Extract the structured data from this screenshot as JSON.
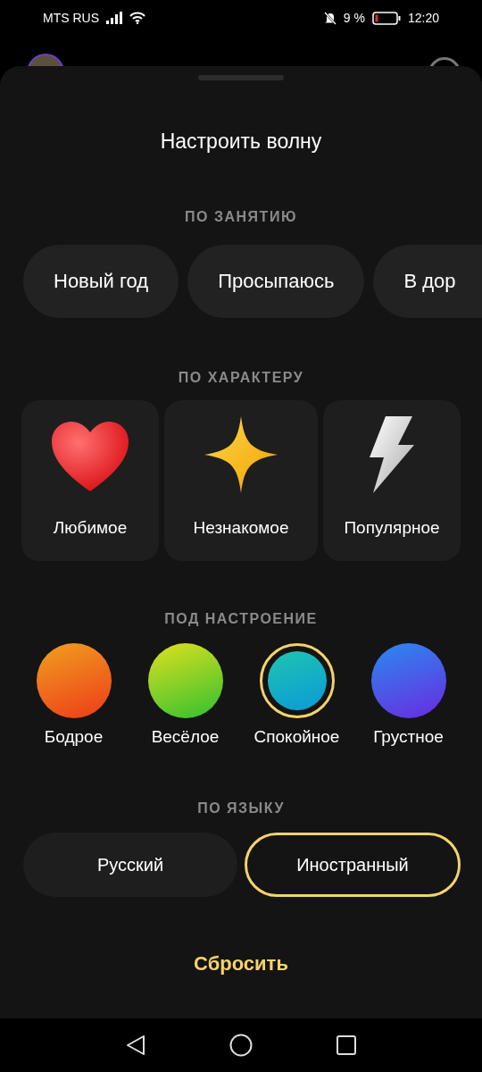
{
  "status_bar": {
    "carrier": "MTS RUS",
    "battery_percent": "9 %",
    "time": "12:20"
  },
  "sheet": {
    "title": "Настроить волну",
    "activity": {
      "heading": "ПО ЗАНЯТИЮ",
      "chips": [
        {
          "label": "Новый год"
        },
        {
          "label": "Просыпаюсь"
        },
        {
          "label": "В дор"
        }
      ]
    },
    "character": {
      "heading": "ПО ХАРАКТЕРУ",
      "cards": [
        {
          "label": "Любимое",
          "kind": "heart"
        },
        {
          "label": "Незнакомое",
          "kind": "star"
        },
        {
          "label": "Популярное",
          "kind": "lightning"
        }
      ]
    },
    "mood": {
      "heading": "ПОД НАСТРОЕНИЕ",
      "options": [
        {
          "label": "Бодрое",
          "color": "#f05a1a",
          "selected": false
        },
        {
          "label": "Весёлое",
          "color": "#7fd41c",
          "selected": false
        },
        {
          "label": "Спокойное",
          "color": "#12b5c4",
          "selected": true
        },
        {
          "label": "Грустное",
          "color": "#5a3df0",
          "selected": false
        }
      ]
    },
    "language": {
      "heading": "ПО ЯЗЫКУ",
      "options": [
        {
          "label": "Русский",
          "selected": false
        },
        {
          "label": "Иностранный",
          "selected": true
        }
      ]
    },
    "reset": "Сбросить"
  }
}
